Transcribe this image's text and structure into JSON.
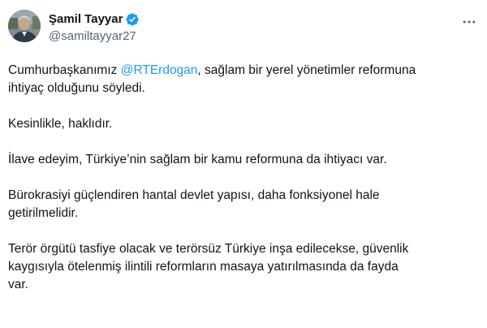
{
  "author": {
    "name": "Şamil Tayyar",
    "handle": "@samiltayyar27"
  },
  "icons": {
    "verified": "verified-badge-icon",
    "more": "more-options-icon",
    "verified_color": "#1d9bf0"
  },
  "tweet": {
    "p1_pre": "Cumhurbaşkanımız ",
    "p1_mention": "@RTErdogan",
    "p1_post": ", sağlam bir yerel yönetimler reformuna",
    "p1_line2": "ihtiyaç olduğunu söyledi.",
    "p2": "Kesinlikle, haklıdır.",
    "p3": "İlave edeyim, Türkiye’nin sağlam bir kamu reformuna da ihtiyacı var.",
    "p4_line1": "Bürokrasiyi güçlendiren hantal devlet yapısı, daha fonksiyonel hale",
    "p4_line2": "getirilmelidir.",
    "p5_line1": "Terör örgütü tasfiye olacak ve terörsüz Türkiye inşa edilecekse, güvenlik",
    "p5_line2": "kaygısıyla ötelenmiş ilintili reformların masaya yatırılmasında da fayda",
    "p5_line3": "var."
  }
}
